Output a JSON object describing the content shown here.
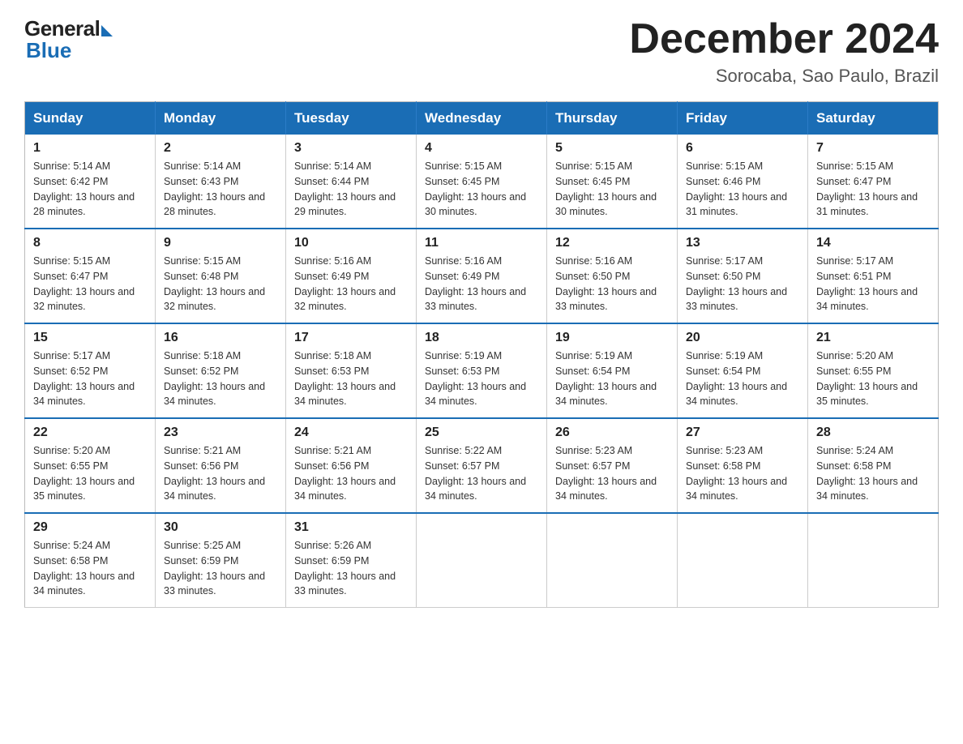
{
  "logo": {
    "general": "General",
    "blue": "Blue"
  },
  "title": "December 2024",
  "location": "Sorocaba, Sao Paulo, Brazil",
  "weekdays": [
    "Sunday",
    "Monday",
    "Tuesday",
    "Wednesday",
    "Thursday",
    "Friday",
    "Saturday"
  ],
  "weeks": [
    [
      {
        "day": "1",
        "sunrise": "5:14 AM",
        "sunset": "6:42 PM",
        "daylight": "13 hours and 28 minutes."
      },
      {
        "day": "2",
        "sunrise": "5:14 AM",
        "sunset": "6:43 PM",
        "daylight": "13 hours and 28 minutes."
      },
      {
        "day": "3",
        "sunrise": "5:14 AM",
        "sunset": "6:44 PM",
        "daylight": "13 hours and 29 minutes."
      },
      {
        "day": "4",
        "sunrise": "5:15 AM",
        "sunset": "6:45 PM",
        "daylight": "13 hours and 30 minutes."
      },
      {
        "day": "5",
        "sunrise": "5:15 AM",
        "sunset": "6:45 PM",
        "daylight": "13 hours and 30 minutes."
      },
      {
        "day": "6",
        "sunrise": "5:15 AM",
        "sunset": "6:46 PM",
        "daylight": "13 hours and 31 minutes."
      },
      {
        "day": "7",
        "sunrise": "5:15 AM",
        "sunset": "6:47 PM",
        "daylight": "13 hours and 31 minutes."
      }
    ],
    [
      {
        "day": "8",
        "sunrise": "5:15 AM",
        "sunset": "6:47 PM",
        "daylight": "13 hours and 32 minutes."
      },
      {
        "day": "9",
        "sunrise": "5:15 AM",
        "sunset": "6:48 PM",
        "daylight": "13 hours and 32 minutes."
      },
      {
        "day": "10",
        "sunrise": "5:16 AM",
        "sunset": "6:49 PM",
        "daylight": "13 hours and 32 minutes."
      },
      {
        "day": "11",
        "sunrise": "5:16 AM",
        "sunset": "6:49 PM",
        "daylight": "13 hours and 33 minutes."
      },
      {
        "day": "12",
        "sunrise": "5:16 AM",
        "sunset": "6:50 PM",
        "daylight": "13 hours and 33 minutes."
      },
      {
        "day": "13",
        "sunrise": "5:17 AM",
        "sunset": "6:50 PM",
        "daylight": "13 hours and 33 minutes."
      },
      {
        "day": "14",
        "sunrise": "5:17 AM",
        "sunset": "6:51 PM",
        "daylight": "13 hours and 34 minutes."
      }
    ],
    [
      {
        "day": "15",
        "sunrise": "5:17 AM",
        "sunset": "6:52 PM",
        "daylight": "13 hours and 34 minutes."
      },
      {
        "day": "16",
        "sunrise": "5:18 AM",
        "sunset": "6:52 PM",
        "daylight": "13 hours and 34 minutes."
      },
      {
        "day": "17",
        "sunrise": "5:18 AM",
        "sunset": "6:53 PM",
        "daylight": "13 hours and 34 minutes."
      },
      {
        "day": "18",
        "sunrise": "5:19 AM",
        "sunset": "6:53 PM",
        "daylight": "13 hours and 34 minutes."
      },
      {
        "day": "19",
        "sunrise": "5:19 AM",
        "sunset": "6:54 PM",
        "daylight": "13 hours and 34 minutes."
      },
      {
        "day": "20",
        "sunrise": "5:19 AM",
        "sunset": "6:54 PM",
        "daylight": "13 hours and 34 minutes."
      },
      {
        "day": "21",
        "sunrise": "5:20 AM",
        "sunset": "6:55 PM",
        "daylight": "13 hours and 35 minutes."
      }
    ],
    [
      {
        "day": "22",
        "sunrise": "5:20 AM",
        "sunset": "6:55 PM",
        "daylight": "13 hours and 35 minutes."
      },
      {
        "day": "23",
        "sunrise": "5:21 AM",
        "sunset": "6:56 PM",
        "daylight": "13 hours and 34 minutes."
      },
      {
        "day": "24",
        "sunrise": "5:21 AM",
        "sunset": "6:56 PM",
        "daylight": "13 hours and 34 minutes."
      },
      {
        "day": "25",
        "sunrise": "5:22 AM",
        "sunset": "6:57 PM",
        "daylight": "13 hours and 34 minutes."
      },
      {
        "day": "26",
        "sunrise": "5:23 AM",
        "sunset": "6:57 PM",
        "daylight": "13 hours and 34 minutes."
      },
      {
        "day": "27",
        "sunrise": "5:23 AM",
        "sunset": "6:58 PM",
        "daylight": "13 hours and 34 minutes."
      },
      {
        "day": "28",
        "sunrise": "5:24 AM",
        "sunset": "6:58 PM",
        "daylight": "13 hours and 34 minutes."
      }
    ],
    [
      {
        "day": "29",
        "sunrise": "5:24 AM",
        "sunset": "6:58 PM",
        "daylight": "13 hours and 34 minutes."
      },
      {
        "day": "30",
        "sunrise": "5:25 AM",
        "sunset": "6:59 PM",
        "daylight": "13 hours and 33 minutes."
      },
      {
        "day": "31",
        "sunrise": "5:26 AM",
        "sunset": "6:59 PM",
        "daylight": "13 hours and 33 minutes."
      },
      null,
      null,
      null,
      null
    ]
  ]
}
